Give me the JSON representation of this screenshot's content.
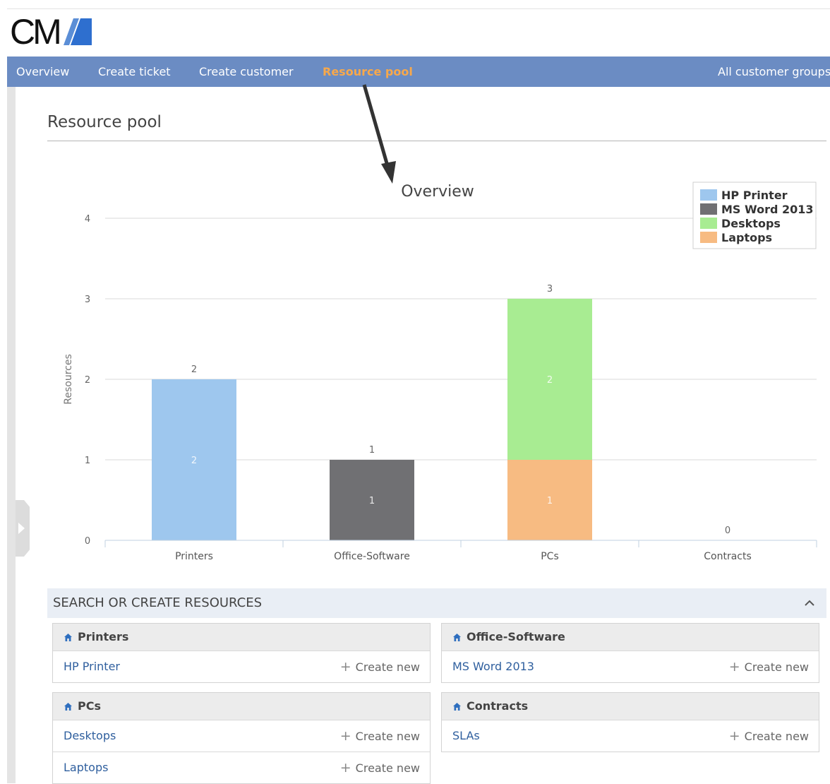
{
  "app": {
    "logo_text": "CM"
  },
  "nav": {
    "items": [
      {
        "label": "Overview"
      },
      {
        "label": "Create ticket"
      },
      {
        "label": "Create customer"
      },
      {
        "label": "Resource pool",
        "active": true
      }
    ],
    "right_label": "All customer groups"
  },
  "page": {
    "title": "Resource pool"
  },
  "chart_data": {
    "type": "bar",
    "stacked": true,
    "title": "Overview",
    "ylabel": "Resources",
    "xlabel": "",
    "categories": [
      "Printers",
      "Office-Software",
      "PCs",
      "Contracts"
    ],
    "yticks": [
      "0",
      "1",
      "2",
      "3",
      "4"
    ],
    "ylim": [
      0,
      4
    ],
    "grid": true,
    "legend_position": "top-right",
    "series": [
      {
        "name": "HP Printer",
        "color": "#9ec7ee",
        "values": [
          2,
          0,
          0,
          0
        ]
      },
      {
        "name": "MS Word 2013",
        "color": "#707073",
        "values": [
          0,
          1,
          0,
          0
        ]
      },
      {
        "name": "Desktops",
        "color": "#a8ec92",
        "values": [
          0,
          0,
          2,
          0
        ]
      },
      {
        "name": "Laptops",
        "color": "#f7bb82",
        "values": [
          0,
          0,
          1,
          0
        ]
      }
    ],
    "totals": [
      2,
      1,
      3,
      0
    ]
  },
  "annotation": {
    "arrow": "dark-arrow pointing from Resource pool tab to chart title"
  },
  "resources_panel": {
    "title": "SEARCH OR CREATE RESOURCES",
    "toggle_icon": "chevron-up-icon",
    "create_label": "Create new",
    "groups": [
      {
        "name": "Printers",
        "items": [
          "HP Printer"
        ]
      },
      {
        "name": "Office-Software",
        "items": [
          "MS Word 2013"
        ]
      },
      {
        "name": "PCs",
        "items": [
          "Desktops",
          "Laptops"
        ]
      },
      {
        "name": "Contracts",
        "items": [
          "SLAs"
        ]
      }
    ]
  },
  "colors": {
    "nav_bg": "#6b8cc3",
    "nav_active": "#f7a84b",
    "link": "#2f5f9e"
  }
}
